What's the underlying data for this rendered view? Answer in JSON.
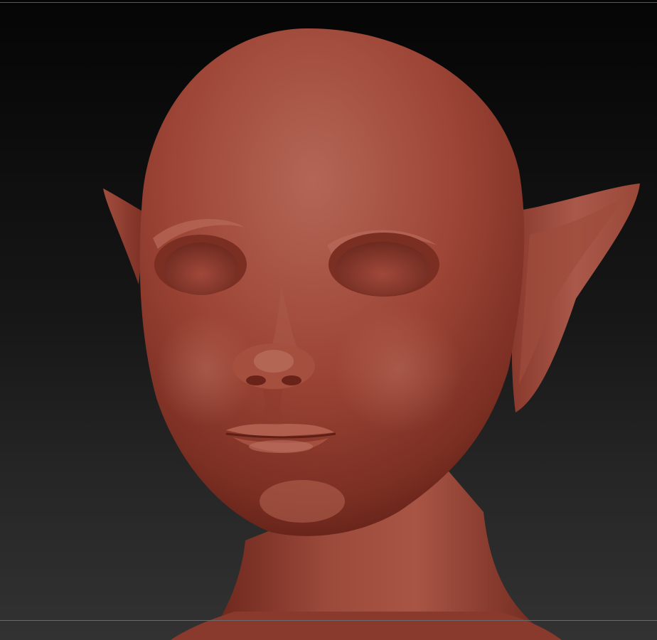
{
  "viewport": {
    "background_top": "#050505",
    "background_bottom": "#323232",
    "frame_line_color": "#5a5a5a"
  },
  "model": {
    "subject": "sculpted-head",
    "material_color": "#a5483a",
    "shadow_color": "#5e1f16",
    "highlight_color": "#c47565"
  }
}
